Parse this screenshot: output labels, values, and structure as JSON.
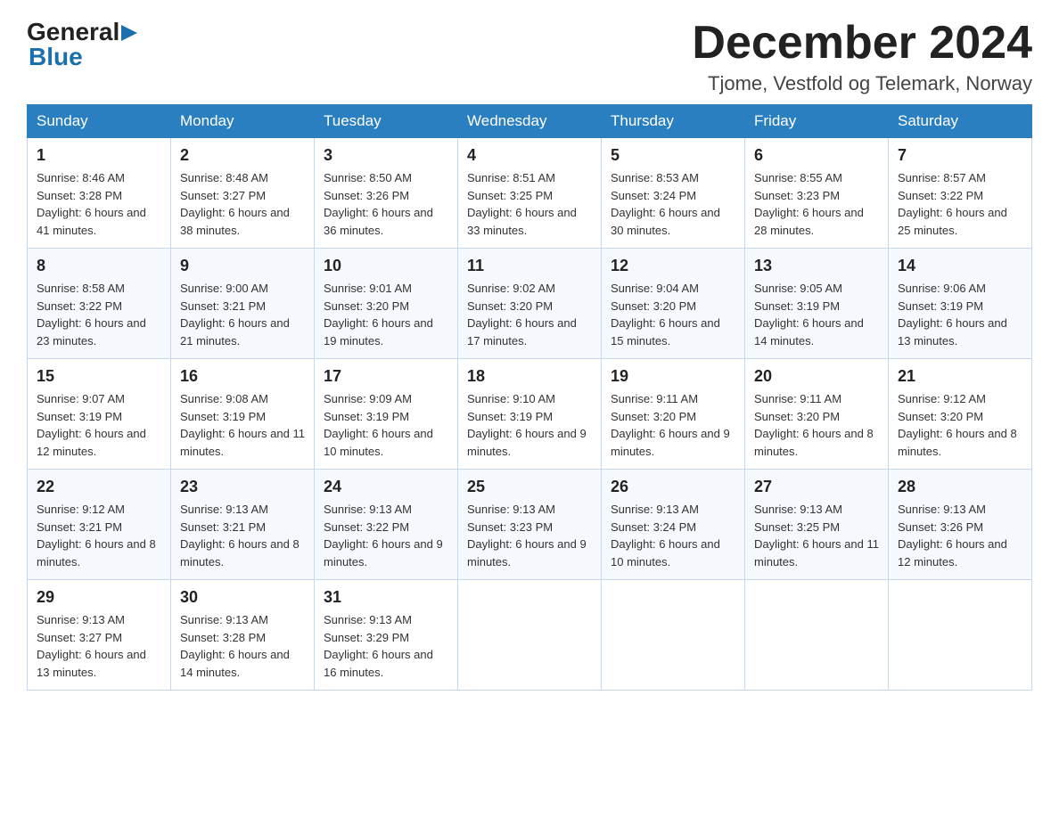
{
  "header": {
    "logo": {
      "general": "General",
      "blue": "Blue",
      "triangle": "▶"
    },
    "month_title": "December 2024",
    "location": "Tjome, Vestfold og Telemark, Norway"
  },
  "columns": [
    "Sunday",
    "Monday",
    "Tuesday",
    "Wednesday",
    "Thursday",
    "Friday",
    "Saturday"
  ],
  "weeks": [
    [
      {
        "day": "1",
        "sunrise": "Sunrise: 8:46 AM",
        "sunset": "Sunset: 3:28 PM",
        "daylight": "Daylight: 6 hours and 41 minutes."
      },
      {
        "day": "2",
        "sunrise": "Sunrise: 8:48 AM",
        "sunset": "Sunset: 3:27 PM",
        "daylight": "Daylight: 6 hours and 38 minutes."
      },
      {
        "day": "3",
        "sunrise": "Sunrise: 8:50 AM",
        "sunset": "Sunset: 3:26 PM",
        "daylight": "Daylight: 6 hours and 36 minutes."
      },
      {
        "day": "4",
        "sunrise": "Sunrise: 8:51 AM",
        "sunset": "Sunset: 3:25 PM",
        "daylight": "Daylight: 6 hours and 33 minutes."
      },
      {
        "day": "5",
        "sunrise": "Sunrise: 8:53 AM",
        "sunset": "Sunset: 3:24 PM",
        "daylight": "Daylight: 6 hours and 30 minutes."
      },
      {
        "day": "6",
        "sunrise": "Sunrise: 8:55 AM",
        "sunset": "Sunset: 3:23 PM",
        "daylight": "Daylight: 6 hours and 28 minutes."
      },
      {
        "day": "7",
        "sunrise": "Sunrise: 8:57 AM",
        "sunset": "Sunset: 3:22 PM",
        "daylight": "Daylight: 6 hours and 25 minutes."
      }
    ],
    [
      {
        "day": "8",
        "sunrise": "Sunrise: 8:58 AM",
        "sunset": "Sunset: 3:22 PM",
        "daylight": "Daylight: 6 hours and 23 minutes."
      },
      {
        "day": "9",
        "sunrise": "Sunrise: 9:00 AM",
        "sunset": "Sunset: 3:21 PM",
        "daylight": "Daylight: 6 hours and 21 minutes."
      },
      {
        "day": "10",
        "sunrise": "Sunrise: 9:01 AM",
        "sunset": "Sunset: 3:20 PM",
        "daylight": "Daylight: 6 hours and 19 minutes."
      },
      {
        "day": "11",
        "sunrise": "Sunrise: 9:02 AM",
        "sunset": "Sunset: 3:20 PM",
        "daylight": "Daylight: 6 hours and 17 minutes."
      },
      {
        "day": "12",
        "sunrise": "Sunrise: 9:04 AM",
        "sunset": "Sunset: 3:20 PM",
        "daylight": "Daylight: 6 hours and 15 minutes."
      },
      {
        "day": "13",
        "sunrise": "Sunrise: 9:05 AM",
        "sunset": "Sunset: 3:19 PM",
        "daylight": "Daylight: 6 hours and 14 minutes."
      },
      {
        "day": "14",
        "sunrise": "Sunrise: 9:06 AM",
        "sunset": "Sunset: 3:19 PM",
        "daylight": "Daylight: 6 hours and 13 minutes."
      }
    ],
    [
      {
        "day": "15",
        "sunrise": "Sunrise: 9:07 AM",
        "sunset": "Sunset: 3:19 PM",
        "daylight": "Daylight: 6 hours and 12 minutes."
      },
      {
        "day": "16",
        "sunrise": "Sunrise: 9:08 AM",
        "sunset": "Sunset: 3:19 PM",
        "daylight": "Daylight: 6 hours and 11 minutes."
      },
      {
        "day": "17",
        "sunrise": "Sunrise: 9:09 AM",
        "sunset": "Sunset: 3:19 PM",
        "daylight": "Daylight: 6 hours and 10 minutes."
      },
      {
        "day": "18",
        "sunrise": "Sunrise: 9:10 AM",
        "sunset": "Sunset: 3:19 PM",
        "daylight": "Daylight: 6 hours and 9 minutes."
      },
      {
        "day": "19",
        "sunrise": "Sunrise: 9:11 AM",
        "sunset": "Sunset: 3:20 PM",
        "daylight": "Daylight: 6 hours and 9 minutes."
      },
      {
        "day": "20",
        "sunrise": "Sunrise: 9:11 AM",
        "sunset": "Sunset: 3:20 PM",
        "daylight": "Daylight: 6 hours and 8 minutes."
      },
      {
        "day": "21",
        "sunrise": "Sunrise: 9:12 AM",
        "sunset": "Sunset: 3:20 PM",
        "daylight": "Daylight: 6 hours and 8 minutes."
      }
    ],
    [
      {
        "day": "22",
        "sunrise": "Sunrise: 9:12 AM",
        "sunset": "Sunset: 3:21 PM",
        "daylight": "Daylight: 6 hours and 8 minutes."
      },
      {
        "day": "23",
        "sunrise": "Sunrise: 9:13 AM",
        "sunset": "Sunset: 3:21 PM",
        "daylight": "Daylight: 6 hours and 8 minutes."
      },
      {
        "day": "24",
        "sunrise": "Sunrise: 9:13 AM",
        "sunset": "Sunset: 3:22 PM",
        "daylight": "Daylight: 6 hours and 9 minutes."
      },
      {
        "day": "25",
        "sunrise": "Sunrise: 9:13 AM",
        "sunset": "Sunset: 3:23 PM",
        "daylight": "Daylight: 6 hours and 9 minutes."
      },
      {
        "day": "26",
        "sunrise": "Sunrise: 9:13 AM",
        "sunset": "Sunset: 3:24 PM",
        "daylight": "Daylight: 6 hours and 10 minutes."
      },
      {
        "day": "27",
        "sunrise": "Sunrise: 9:13 AM",
        "sunset": "Sunset: 3:25 PM",
        "daylight": "Daylight: 6 hours and 11 minutes."
      },
      {
        "day": "28",
        "sunrise": "Sunrise: 9:13 AM",
        "sunset": "Sunset: 3:26 PM",
        "daylight": "Daylight: 6 hours and 12 minutes."
      }
    ],
    [
      {
        "day": "29",
        "sunrise": "Sunrise: 9:13 AM",
        "sunset": "Sunset: 3:27 PM",
        "daylight": "Daylight: 6 hours and 13 minutes."
      },
      {
        "day": "30",
        "sunrise": "Sunrise: 9:13 AM",
        "sunset": "Sunset: 3:28 PM",
        "daylight": "Daylight: 6 hours and 14 minutes."
      },
      {
        "day": "31",
        "sunrise": "Sunrise: 9:13 AM",
        "sunset": "Sunset: 3:29 PM",
        "daylight": "Daylight: 6 hours and 16 minutes."
      },
      null,
      null,
      null,
      null
    ]
  ]
}
